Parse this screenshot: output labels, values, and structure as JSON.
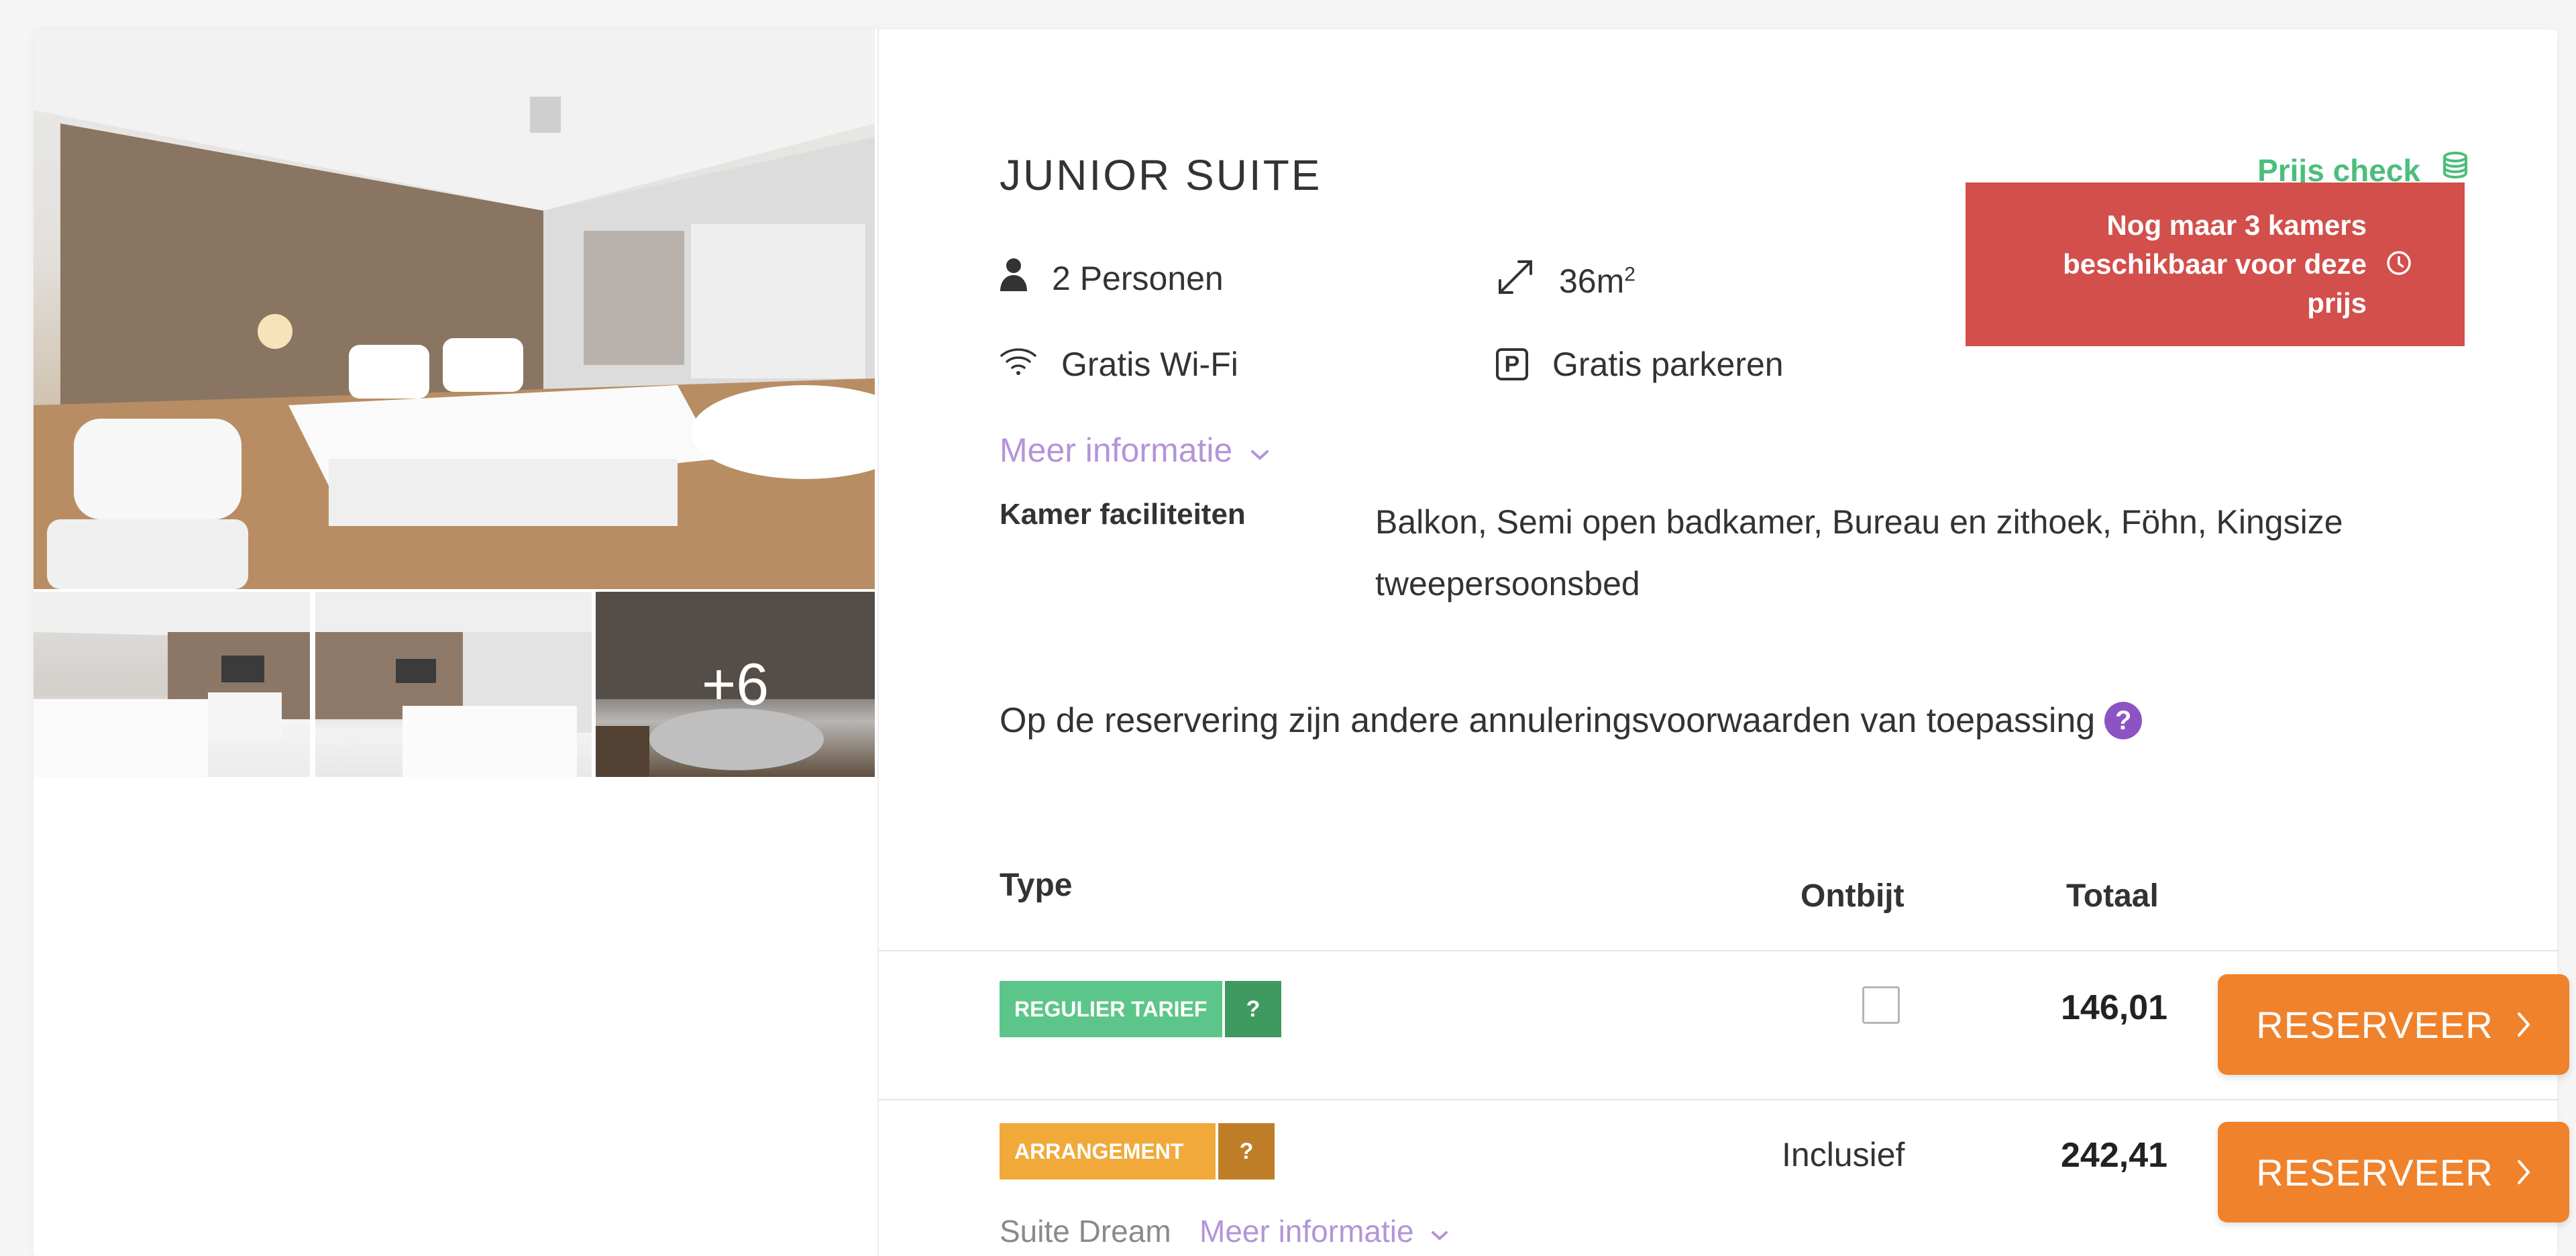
{
  "gallery": {
    "more_count_label": "+6"
  },
  "room": {
    "title": "JUNIOR SUITE",
    "price_check_label": "Prijs check",
    "scarcity_notice": "Nog maar 3 kamers beschikbaar voor deze prijs",
    "features": {
      "persons": "2 Personen",
      "size": "36m",
      "size_sup": "2",
      "wifi": "Gratis Wi-Fi",
      "parking": "Gratis parkeren",
      "parking_icon_letter": "P"
    },
    "more_info_label": "Meer informatie",
    "facilities_label": "Kamer faciliteiten",
    "facilities_value": "Balkon, Semi open badkamer, Bureau en zithoek, Föhn, Kingsize tweepersoonsbed",
    "cancellation_note": "Op de reservering zijn andere annuleringsvoorwaarden van toepassing",
    "help_icon_char": "?"
  },
  "rates_table": {
    "headers": {
      "type": "Type",
      "breakfast": "Ontbijt",
      "total": "Totaal"
    },
    "rows": [
      {
        "tag_label": "REGULIER TARIEF",
        "tag_help": "?",
        "breakfast_checked": false,
        "price": "146,01",
        "button_label": "RESERVEER"
      },
      {
        "tag_label": "ARRANGEMENT",
        "tag_help": "?",
        "breakfast_text": "Inclusief",
        "price": "242,41",
        "button_label": "RESERVEER",
        "package_name": "Suite Dream",
        "more_info_label": "Meer informatie"
      }
    ]
  },
  "colors": {
    "accent_purple": "#b394d9",
    "price_check_green": "#4cbe7c",
    "scarcity_red": "#d24f4c",
    "reserve_orange": "#f0822b",
    "regular_tag_green": "#5cc68a",
    "arrangement_tag_orange": "#f1a93a"
  }
}
